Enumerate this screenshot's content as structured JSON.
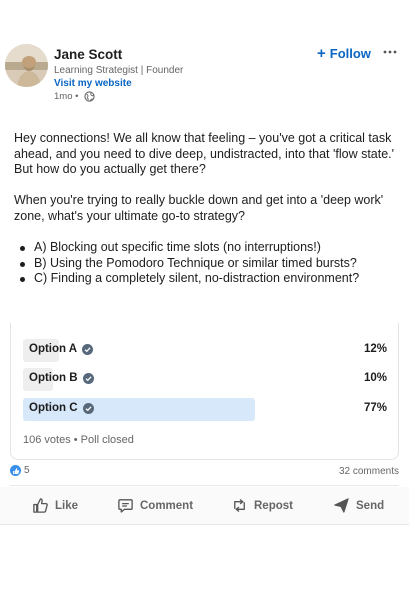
{
  "author": {
    "name": "Jane Scott",
    "headline": "Learning Strategist | Founder",
    "website_link": "Visit my website",
    "time_ago": "1mo •",
    "follow_label": "Follow"
  },
  "post": {
    "paragraphs": [
      "Hey connections! We all know that feeling – you've got a critical task ahead, and you need to dive deep, undistracted, into that 'flow state.' But how do you actually get there?",
      "When you're trying to really buckle down and get into a 'deep work' zone, what's your ultimate go-to strategy?"
    ],
    "options": [
      "A) Blocking out specific time slots (no interruptions!)",
      "B) Using the Pomodoro Technique or similar timed bursts?",
      "C) Finding a completely silent, no-distraction environment?"
    ]
  },
  "poll": {
    "options": [
      {
        "label": "Option A",
        "percent_text": "12%",
        "percent": 12,
        "selected": false
      },
      {
        "label": "Option B",
        "percent_text": "10%",
        "percent": 10,
        "selected": false
      },
      {
        "label": "Option C",
        "percent_text": "77%",
        "percent": 77,
        "selected": true
      }
    ],
    "footer": "106 votes • Poll closed"
  },
  "social": {
    "reactions": "5",
    "comments": "32 comments"
  },
  "actions": {
    "like": "Like",
    "comment": "Comment",
    "repost": "Repost",
    "send": "Send"
  },
  "colors": {
    "accent": "#0a66c2",
    "selected_bar": "#d6e8fa",
    "bar": "#eeeeee",
    "check": "#56687a"
  },
  "icons": [
    "globe-icon",
    "plus-icon",
    "more-icon",
    "check-icon",
    "like-reaction-icon",
    "like-icon",
    "comment-icon",
    "repost-icon",
    "send-icon"
  ]
}
